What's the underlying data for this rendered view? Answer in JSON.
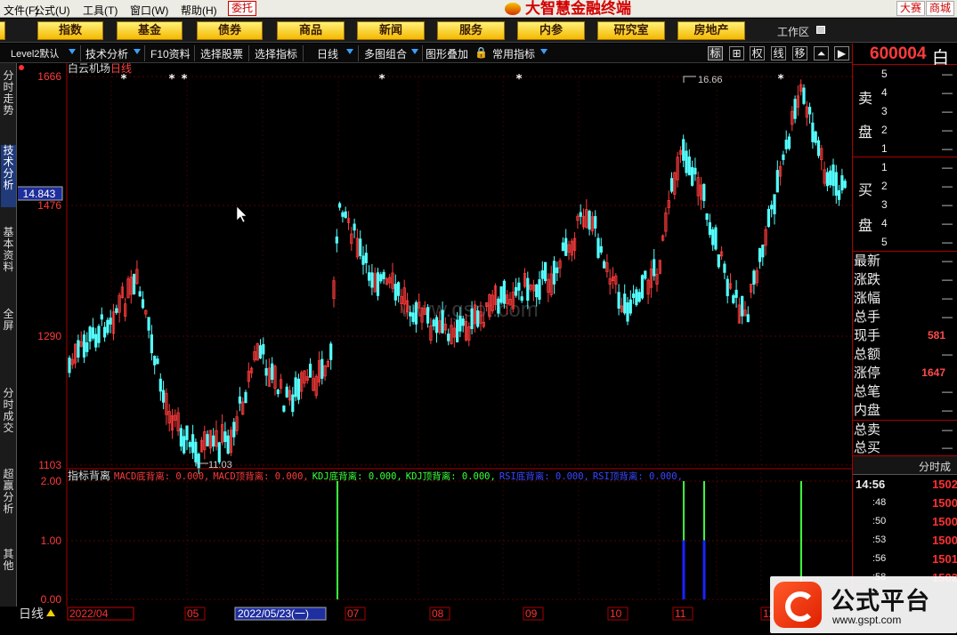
{
  "menubar": {
    "items": [
      "文件(F)",
      "公式(U)",
      "工具(T)",
      "窗口(W)",
      "帮助(H)"
    ],
    "entrust": "委托",
    "brand": "大智慧金融终端",
    "contest": "大赛",
    "mall": "商城"
  },
  "navbar": {
    "buttons": [
      "指数",
      "基金",
      "债券",
      "商品",
      "新闻",
      "服务",
      "内参",
      "研究室",
      "房地产"
    ],
    "workzone": "工作区"
  },
  "toolbar": {
    "items": [
      "Level2默认",
      "技术分析",
      "F10资料",
      "选择股票",
      "选择指标",
      "日线",
      "多图组合",
      "图形叠加",
      "常用指标"
    ],
    "tool_icons": [
      "标",
      "⊞",
      "权",
      "线",
      "移",
      "⏶",
      "▶"
    ]
  },
  "left_tabs": [
    "分时走势",
    "技术分析",
    "基本资料",
    "全屏",
    "分时成交",
    "超赢分析",
    "其他"
  ],
  "chart": {
    "stock_name": "白云机场",
    "period": "日线",
    "y_labels": [
      "1666",
      "1476",
      "1290",
      "1103"
    ],
    "cursor_price": "14.843",
    "high_label": "16.66",
    "low_label": "11.03",
    "watermark_text": "www.gspt.com",
    "indicator_title": "指标背离",
    "indicator_terms": [
      {
        "text": "MACD底背离: 0.000,",
        "color": "#ff3b3b"
      },
      {
        "text": "MACD顶背离: 0.000,",
        "color": "#ff3b3b"
      },
      {
        "text": "KDJ底背离: 0.000,",
        "color": "#3cff3c"
      },
      {
        "text": "KDJ顶背离: 0.000,",
        "color": "#3cff3c"
      },
      {
        "text": "RSI底背离: 0.000,",
        "color": "#3a46ff"
      },
      {
        "text": "RSI顶背离: 0.000,",
        "color": "#3a46ff"
      }
    ],
    "indicator_y_labels": [
      "2.00",
      "1.00",
      "0.00"
    ],
    "period_bottom": "日线",
    "date_start": "2022/04",
    "date_axis_labels": [
      "04",
      "05",
      "06",
      "07",
      "08",
      "09",
      "10",
      "11",
      "12"
    ],
    "date_highlight": "2022/05/23(一)",
    "candle_color_up": "#ff3c3c",
    "candle_color_down": "#54ffff",
    "star_marker": "*"
  },
  "quote": {
    "code": "600004",
    "name": "白",
    "sell_label": [
      "卖",
      "盘"
    ],
    "buy_label": [
      "买",
      "盘"
    ],
    "sell_levels": [
      "5",
      "4",
      "3",
      "2",
      "1"
    ],
    "buy_levels": [
      "1",
      "2",
      "3",
      "4",
      "5"
    ],
    "placeholder": "—",
    "stats": [
      {
        "label": "最新",
        "value": "—"
      },
      {
        "label": "涨跌",
        "value": "—"
      },
      {
        "label": "涨幅",
        "value": "—"
      },
      {
        "label": "总手",
        "value": "—"
      },
      {
        "label": "现手",
        "value": "581"
      },
      {
        "label": "总额",
        "value": "—"
      },
      {
        "label": "涨停",
        "value": "1647"
      },
      {
        "label": "总笔",
        "value": "—"
      },
      {
        "label": "内盘",
        "value": "—"
      },
      {
        "label": "总卖",
        "value": "—"
      },
      {
        "label": "总买",
        "value": "—"
      }
    ],
    "ticks_header": "分时成",
    "ticks": [
      {
        "time": "14:56",
        "price": "1502"
      },
      {
        "time": ":48",
        "price": "1500"
      },
      {
        "time": ":50",
        "price": "1500"
      },
      {
        "time": ":53",
        "price": "1500"
      },
      {
        "time": ":56",
        "price": "1501"
      },
      {
        "time": ":58",
        "price": "1502"
      }
    ]
  },
  "brand_watermark": {
    "title": "公式平台",
    "url": "www.gspt.com"
  }
}
